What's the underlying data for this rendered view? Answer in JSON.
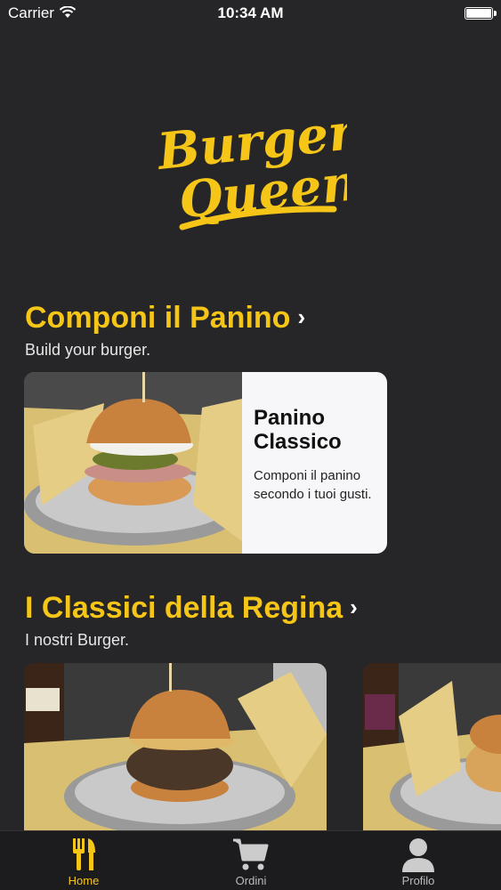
{
  "status_bar": {
    "carrier": "Carrier",
    "time": "10:34 AM"
  },
  "logo": {
    "text_line1": "Burger",
    "text_line2": "Queen"
  },
  "sections": [
    {
      "title": "Componi il Panino",
      "subtitle": "Build your burger.",
      "card": {
        "title": "Panino Classico",
        "description": "Componi il panino secondo i tuoi gusti."
      }
    },
    {
      "title": "I Classici della Regina",
      "subtitle": "I nostri Burger."
    }
  ],
  "tabs": [
    {
      "label": "Home",
      "icon": "fork-knife-icon",
      "active": true
    },
    {
      "label": "Ordini",
      "icon": "cart-icon",
      "active": false
    },
    {
      "label": "Profilo",
      "icon": "person-icon",
      "active": false
    }
  ],
  "colors": {
    "accent": "#f5c518",
    "background": "#262628",
    "tabbar": "#1c1c1e"
  }
}
